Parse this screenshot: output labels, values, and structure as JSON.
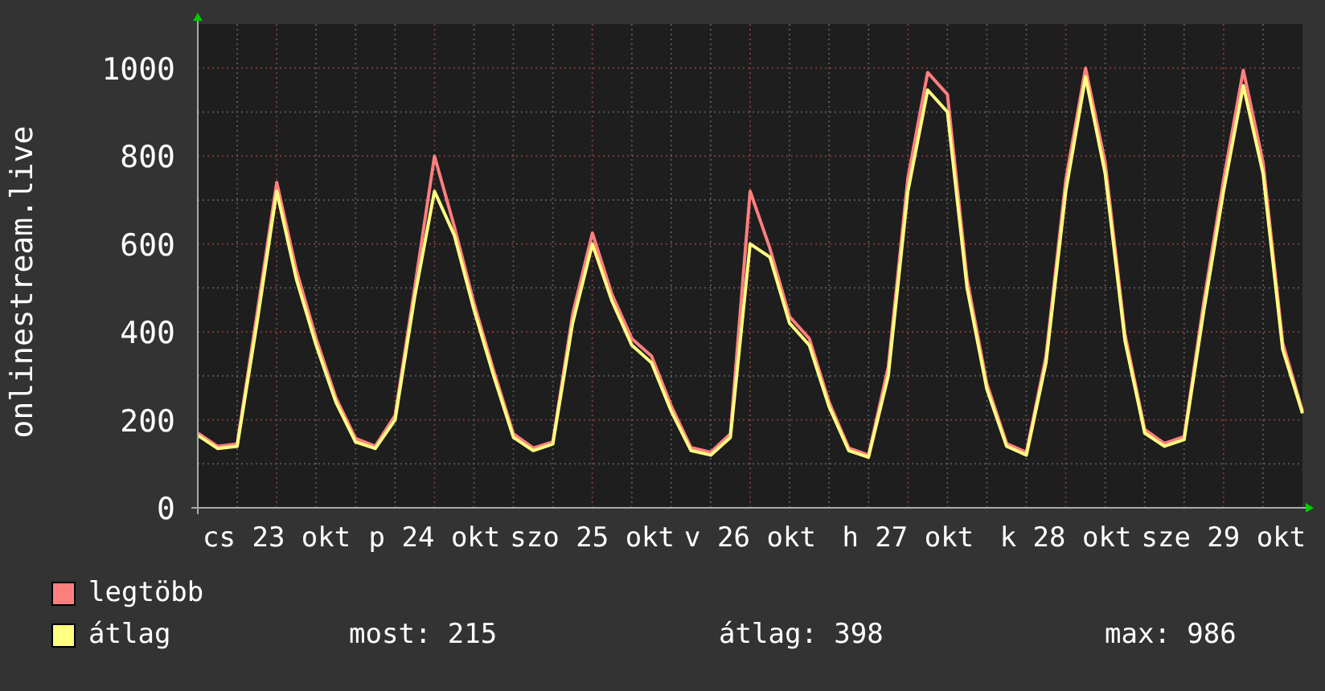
{
  "graph": {
    "chart_data": {
      "type": "line",
      "grid": true,
      "ylabel": "onlinestream.live",
      "ylim": [
        0,
        1100
      ],
      "yticks": [
        0,
        200,
        400,
        600,
        800,
        1000
      ],
      "categories": [
        null,
        null,
        null,
        null,
        "cs 23 okt",
        null,
        null,
        null,
        null,
        null,
        null,
        null,
        "p 24 okt",
        null,
        null,
        null,
        null,
        null,
        null,
        null,
        "szo 25 okt",
        null,
        null,
        null,
        null,
        null,
        null,
        null,
        "v 26 okt",
        null,
        null,
        null,
        null,
        null,
        null,
        null,
        "h 27 okt",
        null,
        null,
        null,
        null,
        null,
        null,
        null,
        "k 28 okt",
        null,
        null,
        null,
        null,
        null,
        null,
        null,
        "sze 29 okt",
        null,
        null,
        null,
        null
      ],
      "series": [
        {
          "name": "legtöbb",
          "color": "#ff7f7f",
          "values": [
            170,
            140,
            145,
            440,
            740,
            540,
            385,
            250,
            158,
            140,
            210,
            500,
            800,
            640,
            465,
            312,
            168,
            136,
            150,
            440,
            625,
            485,
            385,
            345,
            232,
            137,
            126,
            168,
            720,
            590,
            435,
            385,
            240,
            136,
            120,
            320,
            750,
            990,
            940,
            520,
            282,
            146,
            126,
            345,
            745,
            1000,
            785,
            395,
            178,
            146,
            162,
            470,
            745,
            995,
            785,
            375,
            220
          ]
        },
        {
          "name": "átlag",
          "color": "#ffff80",
          "values": [
            165,
            135,
            140,
            420,
            720,
            520,
            370,
            240,
            150,
            135,
            200,
            480,
            720,
            620,
            450,
            300,
            160,
            130,
            145,
            420,
            600,
            470,
            370,
            330,
            220,
            130,
            120,
            160,
            600,
            570,
            420,
            370,
            230,
            130,
            115,
            300,
            720,
            950,
            900,
            500,
            270,
            140,
            120,
            330,
            720,
            980,
            760,
            380,
            170,
            140,
            155,
            450,
            720,
            960,
            760,
            360,
            215
          ]
        }
      ]
    }
  },
  "stats": [
    "most: 215",
    "átlag: 398",
    "max: 986"
  ]
}
